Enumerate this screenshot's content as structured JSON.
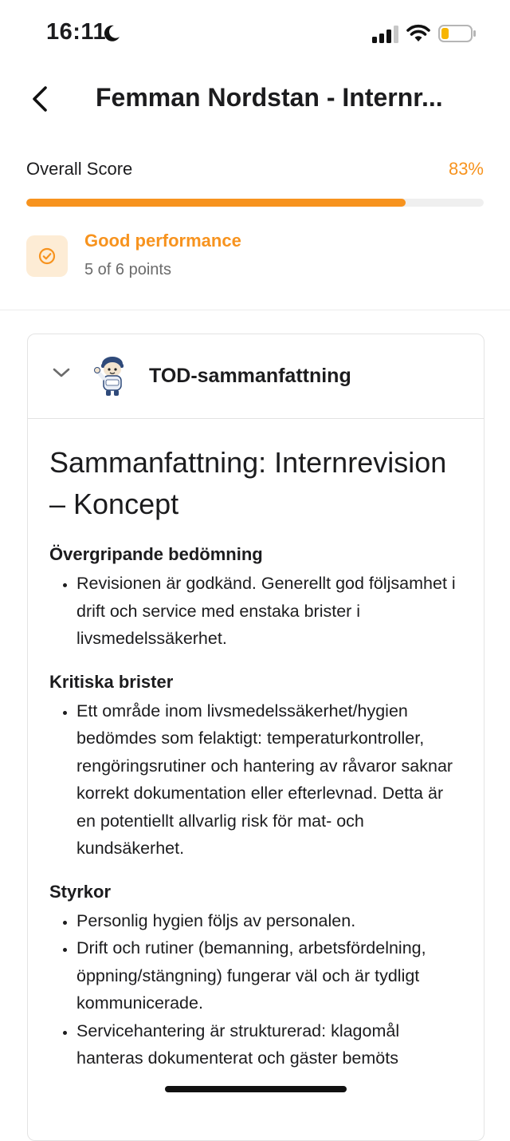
{
  "status_bar": {
    "time": "16:11"
  },
  "nav": {
    "title": "Femman Nordstan - Internr..."
  },
  "score": {
    "label": "Overall Score",
    "value": "83%",
    "progress_percent": 83,
    "accent_color": "#f7931e"
  },
  "performance": {
    "title": "Good performance",
    "subtitle": "5 of 6 points"
  },
  "summary_card": {
    "header_title": "TOD-sammanfattning",
    "heading": "Sammanfattning: Internrevision – Koncept",
    "sections": [
      {
        "title": "Övergripande bedömning",
        "items": [
          "Revisionen är godkänd. Generellt god följsamhet i drift och service med enstaka brister i livsmedelssäkerhet."
        ]
      },
      {
        "title": "Kritiska brister",
        "items": [
          "Ett område inom livsmedelssäkerhet/hygien bedömdes som felaktigt: temperaturkontroller, rengöringsrutiner och hantering av råvaror saknar korrekt dokumentation eller efterlevnad. Detta är en potentiellt allvarlig risk för mat- och kundsäkerhet."
        ]
      },
      {
        "title": "Styrkor",
        "items": [
          "Personlig hygien följs av personalen.",
          "Drift och rutiner (bemanning, arbetsfördelning, öppning/stängning) fungerar väl och är tydligt kommunicerade.",
          "Servicehantering är strukturerad: klagomål hanteras dokumenterat och gäster bemöts"
        ]
      }
    ]
  }
}
